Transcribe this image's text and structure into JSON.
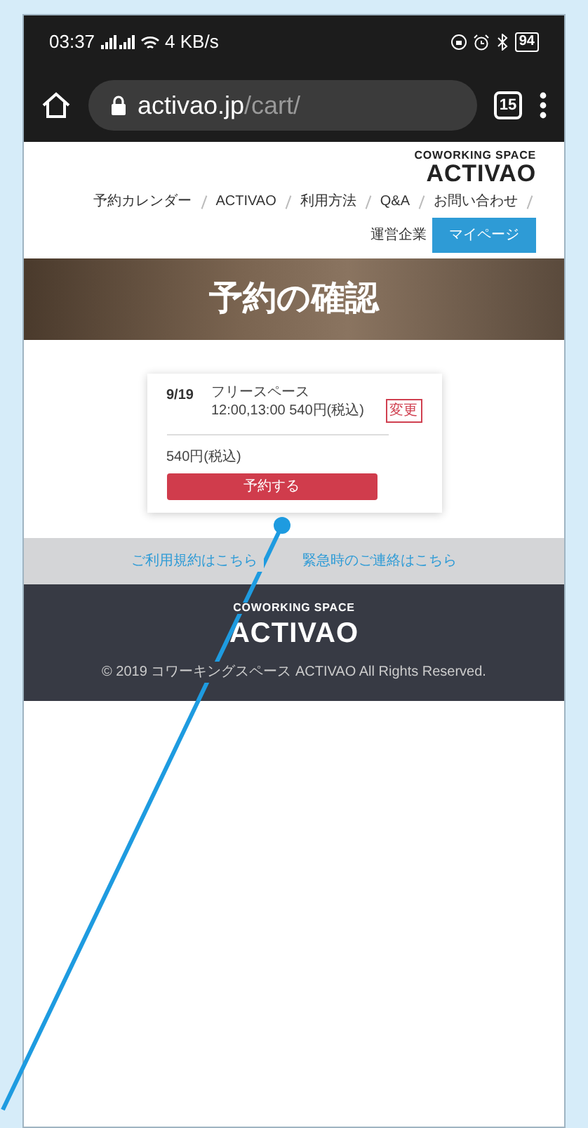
{
  "status_bar": {
    "time": "03:37",
    "speed": "4 KB/s",
    "battery": "94"
  },
  "browser": {
    "domain": "activao.jp",
    "path": "/cart/",
    "tab_count": "15"
  },
  "header": {
    "logo_top": "COWORKING SPACE",
    "logo": "ACTIVAO",
    "nav": [
      {
        "label": "予約カレンダー",
        "kind": "link"
      },
      {
        "label": "ACTIVAO",
        "kind": "link"
      },
      {
        "label": "利用方法",
        "kind": "link"
      },
      {
        "label": "Q&A",
        "kind": "link"
      },
      {
        "label": "お問い合わせ",
        "kind": "link"
      },
      {
        "label": "運営企業",
        "kind": "link"
      },
      {
        "label": "マイページ",
        "kind": "button"
      }
    ]
  },
  "hero": {
    "title": "予約の確認"
  },
  "cart": {
    "items": [
      {
        "date": "9/19",
        "description": "フリースペース 12:00,13:00 540円(税込)",
        "change": "変更"
      }
    ],
    "total": "540円(税込)",
    "submit": "予約する"
  },
  "footer": {
    "links": [
      "ご利用規約はこちら",
      "緊急時のご連絡はこちら"
    ],
    "logo_top": "COWORKING SPACE",
    "logo": "ACTIVAO",
    "copyright": "© 2019 コワーキングスペース ACTIVAO All Rights Reserved."
  }
}
